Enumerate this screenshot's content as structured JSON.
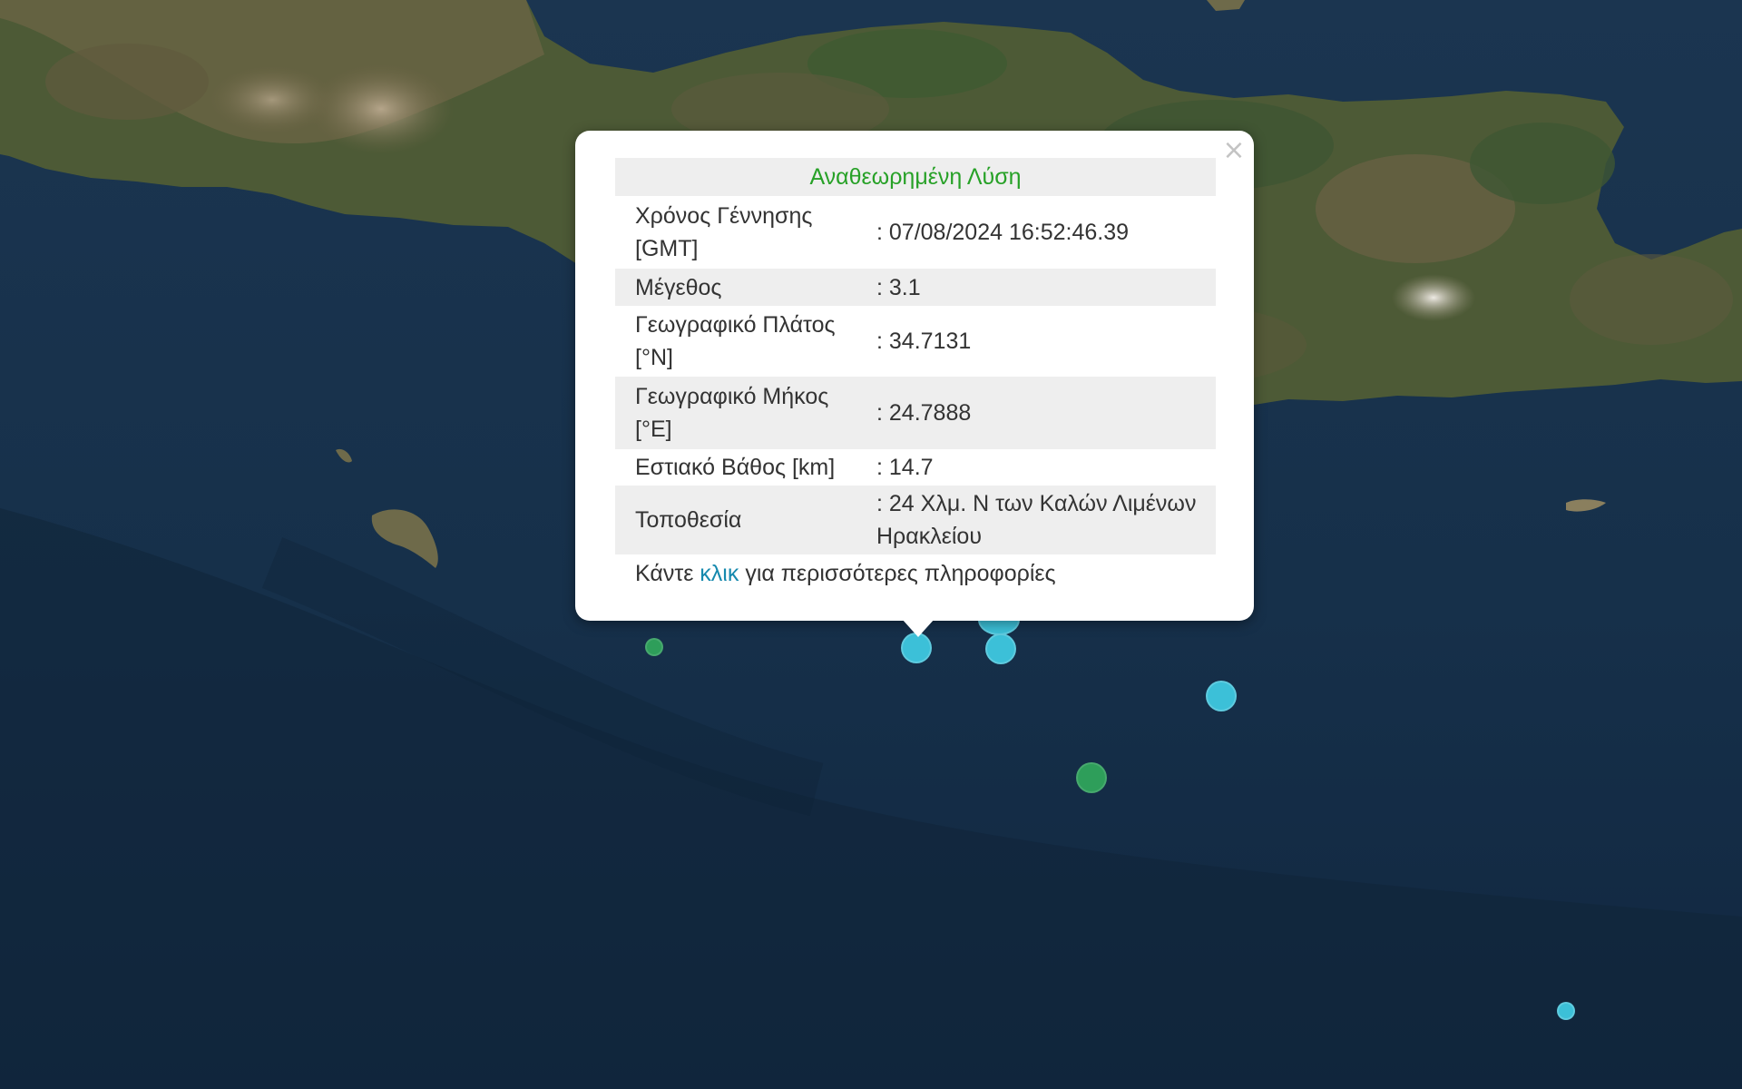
{
  "map": {
    "colors": {
      "sea": "#16304a",
      "land": "#4d5a36",
      "marker_recent": "#3cc0d8",
      "marker_older": "#2e9e5a"
    },
    "markers": [
      {
        "name": "event-selected",
        "color": "blue"
      },
      {
        "name": "event-2",
        "color": "blue"
      },
      {
        "name": "event-3",
        "color": "blue"
      },
      {
        "name": "event-4",
        "color": "blue"
      },
      {
        "name": "event-5",
        "color": "blue"
      },
      {
        "name": "event-6",
        "color": "green"
      },
      {
        "name": "event-7",
        "color": "green"
      }
    ]
  },
  "popup": {
    "close_icon": "close-icon",
    "title": "Αναθεωρημένη Λύση",
    "rows": [
      {
        "label": "Χρόνος Γέννησης [GMT]",
        "value": ": 07/08/2024 16:52:46.39"
      },
      {
        "label": "Μέγεθος",
        "value": ": 3.1"
      },
      {
        "label": "Γεωγραφικό Πλάτος [°N]",
        "value": ": 34.7131"
      },
      {
        "label": "Γεωγραφικό Μήκος [°E]",
        "value": ": 24.7888"
      },
      {
        "label": "Εστιακό Βάθος [km]",
        "value": ": 14.7"
      },
      {
        "label": "Τοποθεσία",
        "value": ": 24 Χλμ. Ν των Καλών Λιμένων Ηρακλείου"
      }
    ],
    "footer": {
      "before": "Κάντε",
      "link": "κλικ",
      "after": "για περισσότερες πληροφορίες"
    }
  }
}
